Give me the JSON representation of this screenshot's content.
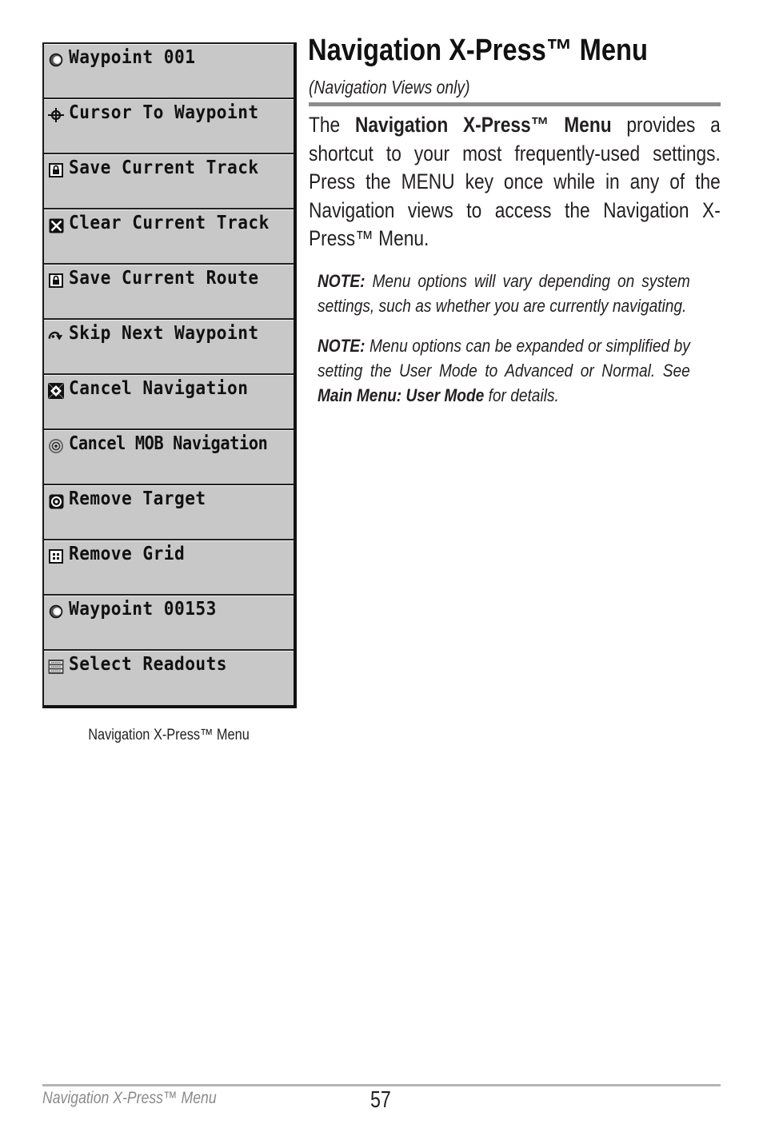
{
  "page": {
    "title": "Navigation X-Press™ Menu",
    "subtitle": "(Navigation Views only)",
    "intro": {
      "prefix": "The ",
      "bold": "Navigation X-Press™ Menu",
      "suffix": " provides a shortcut to your most frequently-used settings. Press the MENU key once while in any of the Navigation views to access the Navigation X-Press™ Menu."
    },
    "notes": [
      {
        "label": "NOTE:",
        "text": " Menu options will vary depending on system settings, such as whether you are currently navigating."
      },
      {
        "label": "NOTE:",
        "text": " Menu options can be expanded or simplified by setting the User Mode to Advanced or Normal. See ",
        "link": "Main Menu: User Mode",
        "after": " for details."
      }
    ]
  },
  "menu": {
    "items": [
      {
        "label": "Waypoint 001",
        "icon": "waypoint-icon"
      },
      {
        "label": "Cursor To Waypoint",
        "icon": "crosshair-icon"
      },
      {
        "label": "Save Current Track",
        "icon": "lock-icon"
      },
      {
        "label": "Clear Current Track",
        "icon": "clear-x-icon"
      },
      {
        "label": "Save Current Route",
        "icon": "lock-icon"
      },
      {
        "label": "Skip Next Waypoint",
        "icon": "skip-arrow-icon"
      },
      {
        "label": "Cancel Navigation",
        "icon": "cancel-navigation-icon"
      },
      {
        "label": "Cancel MOB Navigation",
        "icon": "mob-target-icon"
      },
      {
        "label": "Remove Target",
        "icon": "target-icon"
      },
      {
        "label": "Remove Grid",
        "icon": "grid-icon"
      },
      {
        "label": "Waypoint 00153",
        "icon": "waypoint-icon"
      },
      {
        "label": "Select Readouts",
        "icon": "readouts-icon"
      }
    ],
    "caption": "Navigation X-Press™ Menu"
  },
  "footer": {
    "section": "Navigation X-Press™ Menu",
    "page_number": "57"
  },
  "colors": {
    "menu_background": "#c8c8c8",
    "title_rule": "#8c8c8c",
    "footer_rule": "#b5b5b5",
    "footer_text": "#8a8a8a"
  }
}
